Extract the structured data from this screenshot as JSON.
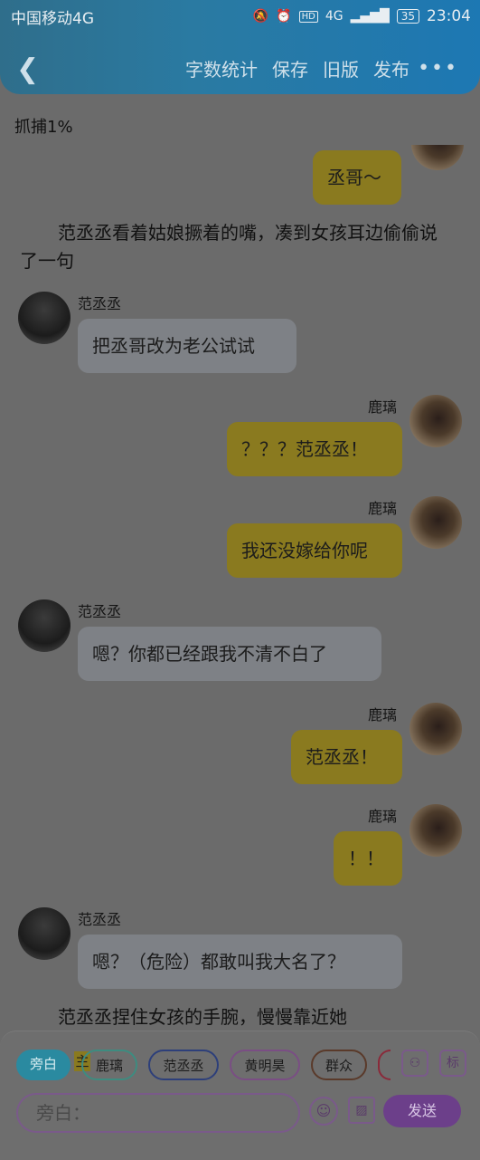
{
  "status_bar": {
    "carrier": "中国移动4G",
    "hd": "HD",
    "signal": "4G",
    "battery": "35",
    "time": "23:04"
  },
  "toolbar": {
    "back_glyph": "❮",
    "menu": [
      "字数统计",
      "保存",
      "旧版",
      "发布"
    ],
    "more_glyph": "•••"
  },
  "capture_label": "抓捕1%",
  "messages": [
    {
      "type": "bubble",
      "side": "right",
      "text": "丞哥～"
    },
    {
      "type": "narration",
      "text": "范丞丞看着姑娘撅着的嘴，凑到女孩耳边偷偷说了一句"
    },
    {
      "type": "bubble",
      "side": "left",
      "name": "范丞丞",
      "text": "把丞哥改为老公试试"
    },
    {
      "type": "bubble",
      "side": "right",
      "name": "鹿璃",
      "text": "？？？范丞丞！"
    },
    {
      "type": "bubble",
      "side": "right",
      "name": "鹿璃",
      "text": "我还没嫁给你呢"
    },
    {
      "type": "bubble",
      "side": "left",
      "name": "范丞丞",
      "text": "嗯？你都已经跟我不清不白了"
    },
    {
      "type": "bubble",
      "side": "right",
      "name": "鹿璃",
      "text": "范丞丞！"
    },
    {
      "type": "bubble",
      "side": "right",
      "name": "鹿璃",
      "text": "！！"
    },
    {
      "type": "bubble",
      "side": "left",
      "name": "范丞丞",
      "text": "嗯？（危险）都敢叫我大名了？"
    },
    {
      "type": "narration",
      "text": "范丞丞捏住女孩的手腕，慢慢靠近她"
    }
  ],
  "roles": {
    "narration": "旁白",
    "main_tag": "主",
    "chips": [
      "鹿璃",
      "范丞丞",
      "黄明昊",
      "群众"
    ]
  },
  "composer": {
    "placeholder": "旁白：",
    "send": "发送",
    "label_icon_text": "标",
    "emoji_glyph": "☺",
    "image_glyph": "▨",
    "person_glyph": "⚇"
  }
}
